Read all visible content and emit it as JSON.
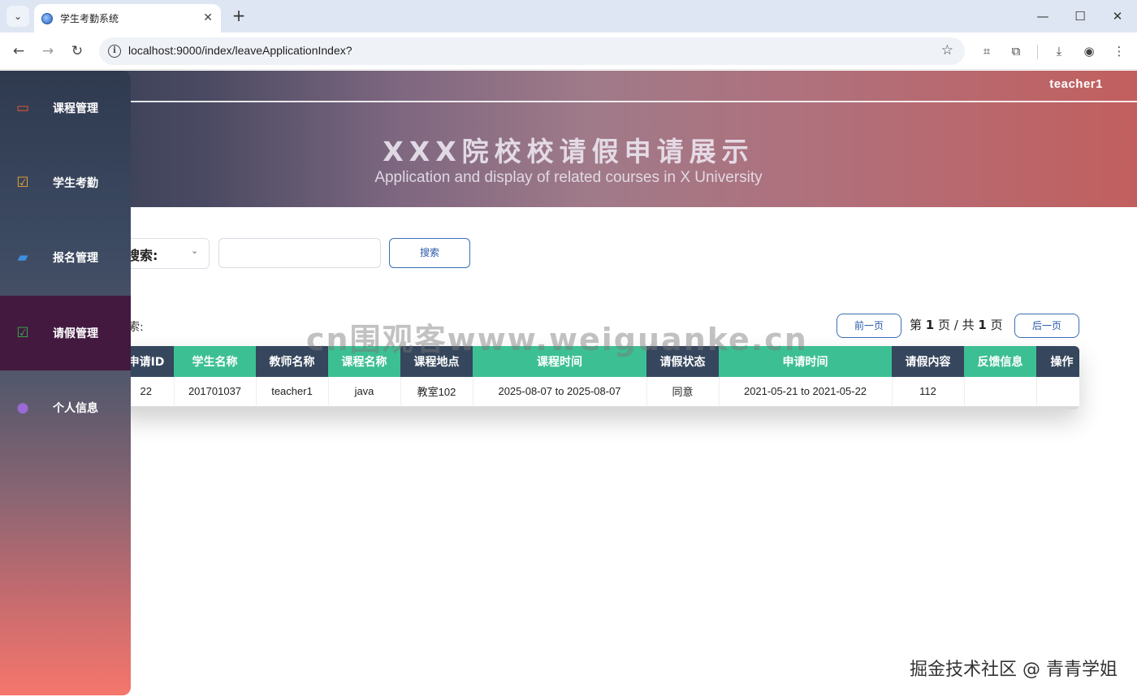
{
  "browser": {
    "tab_title": "学生考勤系统",
    "tab_close": "✕",
    "new_tab": "+",
    "url": "localhost:9000/index/leaveApplicationIndex?"
  },
  "header": {
    "username": "teacher1",
    "title": "XXX院校校请假申请展示",
    "subtitle": "Application and display of related courses in X University"
  },
  "sidebar": {
    "items": [
      {
        "label": "课程管理",
        "icon": "laptop-icon",
        "color": "#e8592d"
      },
      {
        "label": "学生考勤",
        "icon": "calendar-check-icon",
        "color": "#f0a530"
      },
      {
        "label": "报名管理",
        "icon": "book-icon",
        "color": "#3d8fe0"
      },
      {
        "label": "请假管理",
        "icon": "checkbox-icon",
        "color": "#37b24d",
        "active": true
      },
      {
        "label": "个人信息",
        "icon": "user-icon",
        "color": "#9b6ad6"
      }
    ]
  },
  "search": {
    "label": "搜索:",
    "input_placeholder": "",
    "button_label": "搜索"
  },
  "results": {
    "label": "索:",
    "prev_label": "前一页",
    "next_label": "后一页",
    "page_prefix": "第",
    "page_current": "1",
    "page_mid": "页 / 共",
    "page_total": "1",
    "page_suffix": "页"
  },
  "table": {
    "columns": [
      "申请ID",
      "学生名称",
      "教师名称",
      "课程名称",
      "课程地点",
      "课程时间",
      "请假状态",
      "申请时间",
      "请假内容",
      "反馈信息",
      "操作"
    ],
    "rows": [
      [
        "22",
        "201701037",
        "teacher1",
        "java",
        "教室102",
        "2025-08-07 to 2025-08-07",
        "同意",
        "2021-05-21 to 2021-05-22",
        "112",
        "",
        ""
      ]
    ]
  },
  "watermark": "cn围观客www.weiguanke.cn",
  "footer_watermark": "掘金技术社区 @ 青青学姐"
}
